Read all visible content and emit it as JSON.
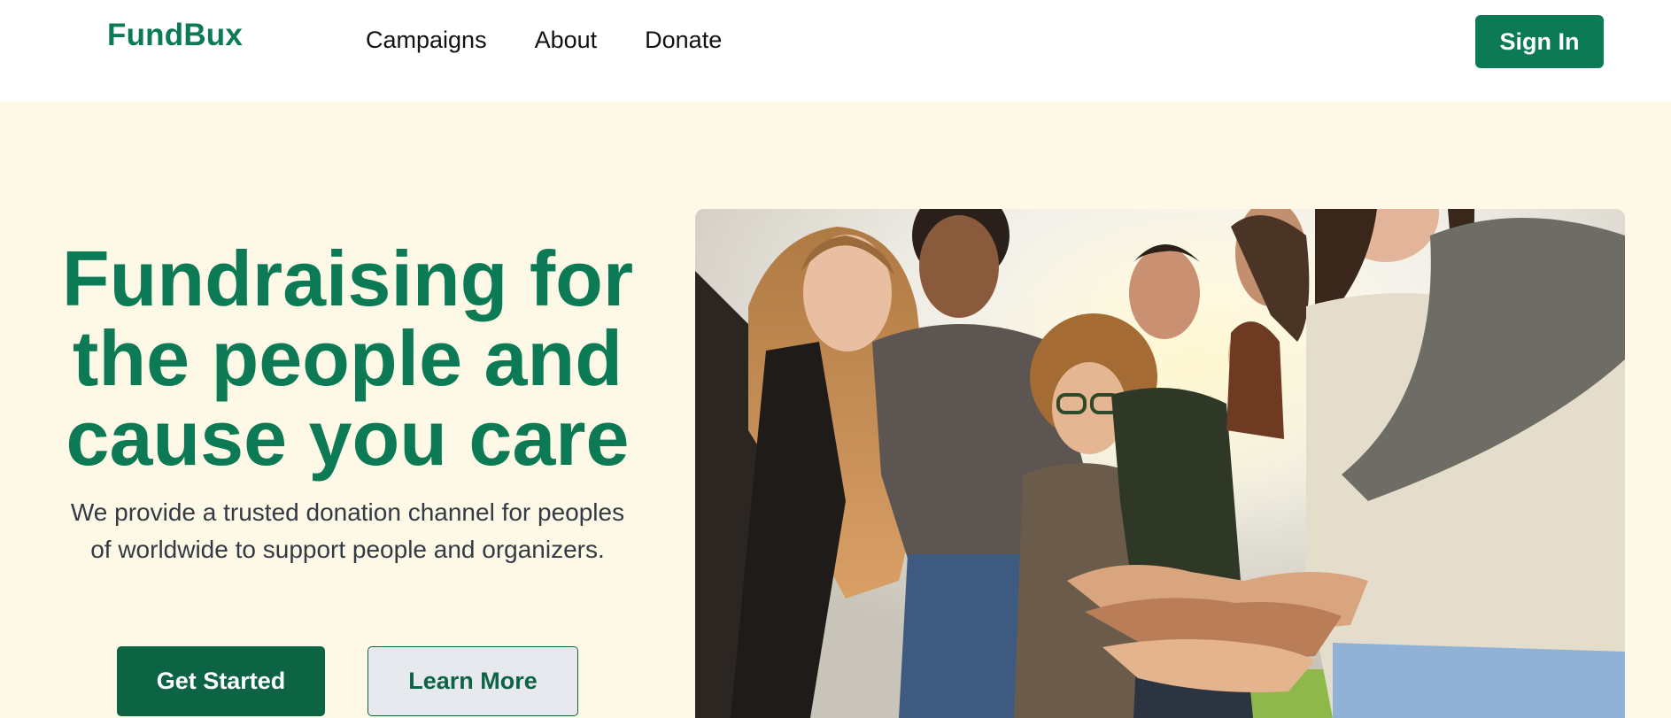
{
  "brand": {
    "name": "FundBux",
    "color": "#0b7a55"
  },
  "nav": {
    "items": [
      {
        "label": "Campaigns"
      },
      {
        "label": "About"
      },
      {
        "label": "Donate"
      }
    ]
  },
  "header": {
    "sign_in_label": "Sign In"
  },
  "hero": {
    "title_line1": "Fundraising for",
    "title_line2": "the people and",
    "title_line3": "cause you care",
    "subtitle": "We provide a trusted donation channel for peoples of worldwide to support people and organizers.",
    "primary_button": "Get Started",
    "secondary_button": "Learn More",
    "background": "#fdf9e6",
    "image_subject": "group of smiling young people stacking hands outdoors"
  }
}
